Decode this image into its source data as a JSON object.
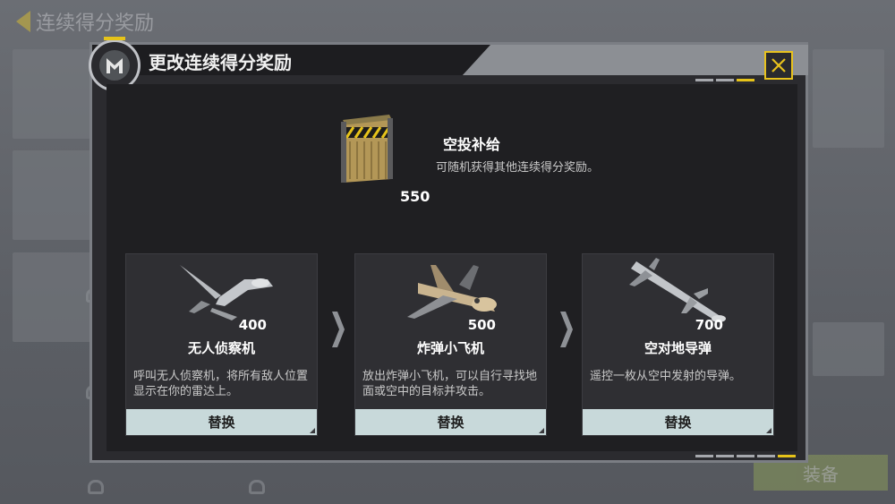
{
  "background": {
    "back_title": "连续得分奖励",
    "equip_label": "装备"
  },
  "dialog": {
    "title": "更改连续得分奖励",
    "close_icon": "close-x-icon",
    "page_indicator_top": [
      false,
      false,
      true
    ],
    "page_indicator_bottom": [
      false,
      false,
      false,
      false,
      true
    ]
  },
  "air_drop": {
    "name": "空投补给",
    "description": "可随机获得其他连续得分奖励。",
    "cost": "550",
    "icon": "supply-crate-icon"
  },
  "rewards": [
    {
      "name": "无人侦察机",
      "cost": "400",
      "description": "呼叫无人侦察机，将所有敌人位置显示在你的雷达上。",
      "button": "替换",
      "icon": "recon-drone-icon"
    },
    {
      "name": "炸弹小飞机",
      "cost": "500",
      "description": "放出炸弹小飞机，可以自行寻找地面或空中的目标并攻击。",
      "button": "替换",
      "icon": "bomb-drone-icon"
    },
    {
      "name": "空对地导弹",
      "cost": "700",
      "description": "遥控一枚从空中发射的导弹。",
      "button": "替换",
      "icon": "missile-icon"
    }
  ],
  "colors": {
    "accent": "#e6c319",
    "button_bg": "#c8d9da",
    "panel_bg": "#1f1f22"
  }
}
